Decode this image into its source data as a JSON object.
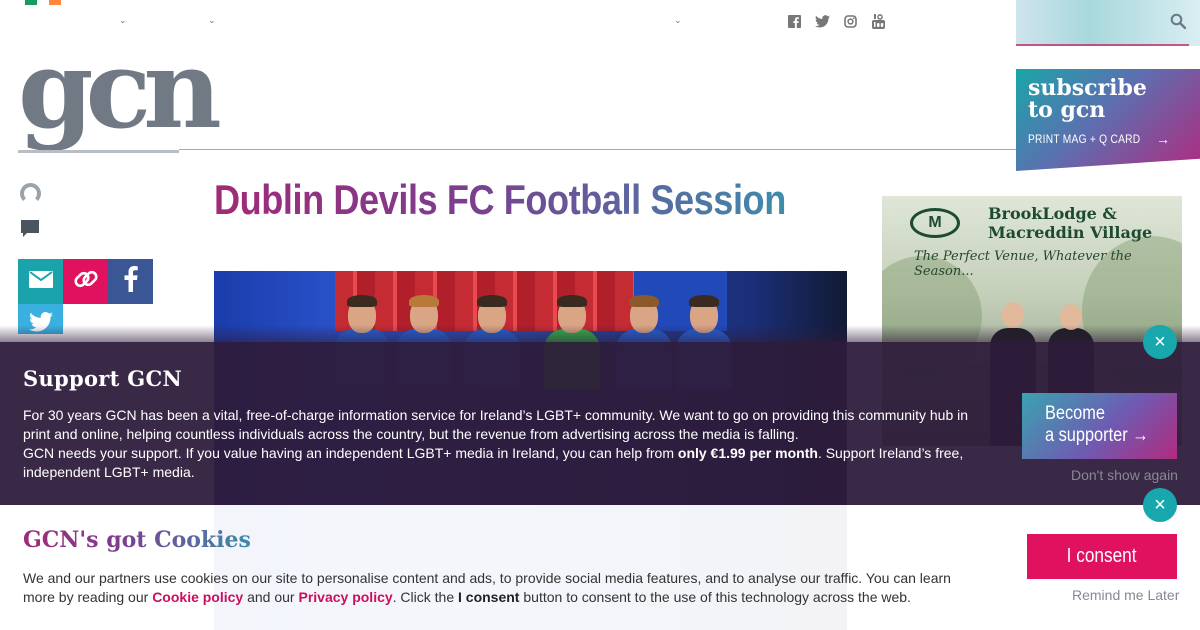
{
  "header": {
    "nav_chevron": "⌄",
    "social_icons": [
      "facebook-icon",
      "twitter-icon",
      "instagram-icon",
      "youtube-icon"
    ],
    "search_icon": "search-icon"
  },
  "logo": {
    "text": "gcn"
  },
  "subscribe": {
    "title": "subscribe to gcn",
    "subtitle": "PRINT MAG + Q CARD",
    "arrow": "→"
  },
  "article": {
    "title": "Dublin Devils FC Football Session"
  },
  "share": {
    "icons": [
      "mail-icon",
      "link-icon",
      "facebook-icon",
      "twitter-icon"
    ]
  },
  "ad": {
    "brand_line1": "BrookLodge &",
    "brand_line2": "Macreddin Village",
    "tagline": "The Perfect Venue, Whatever the Season..."
  },
  "support_banner": {
    "title": "Support GCN",
    "body_line1": "For 30 years GCN has been a vital, free-of-charge information service for Ireland’s LGBT+ community. We want to go on providing this community hub in print and online, helping countless individuals across the country, but the revenue from advertising across the media is falling.",
    "body_line2_start": "GCN needs your support. If you value having an independent LGBT+ media in Ireland, you can help from ",
    "body_line2_bold": "only €1.99 per month",
    "body_line2_end": ". Support Ireland’s free, independent LGBT+ media.",
    "button_line1": "Become",
    "button_line2": "a supporter →",
    "dismiss": "Don't show again",
    "close": "×"
  },
  "cookie_banner": {
    "title": "GCN's got Cookies",
    "text_start": "We and our partners use cookies on our site to personalise content and ads, to provide social media features, and to analyse our traffic. You can learn more by reading our ",
    "cookie_policy": "Cookie policy",
    "text_mid": " and our ",
    "privacy_policy": "Privacy policy",
    "text_mid2": ". Click the ",
    "consent_bold": "I consent",
    "text_end": " button to consent to the use of this technology across the web.",
    "consent_button": "I consent",
    "remind": "Remind me Later",
    "close": "×"
  },
  "colors": {
    "brand_pink": "#e0115e",
    "brand_teal": "#1ba3ac",
    "facebook_blue": "#3a5694",
    "banner_bg": "#2e1c3a"
  }
}
